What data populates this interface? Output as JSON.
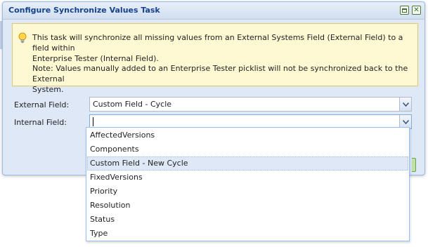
{
  "dialog": {
    "title": "Configure Synchronize Values Task",
    "tools": {
      "maximize_icon": "maximize-icon",
      "close_icon": "close-icon"
    },
    "info": {
      "icon": "lightbulb-icon",
      "line1": "This task will synchronize all missing values from an External Systems Field (External Field) to a field within",
      "line2": "Enterprise Tester (Internal Field).",
      "note1": "Note: Values manually added to an Enterprise Tester picklist will not be synchronized back to the External",
      "note2": "System."
    },
    "external_field": {
      "label": "External Field:",
      "value": "Custom Field - Cycle"
    },
    "internal_field": {
      "label": "Internal Field:",
      "value": ""
    }
  },
  "dropdown": {
    "options": [
      "AffectedVersions",
      "Components",
      "Custom Field - New Cycle",
      "FixedVersions",
      "Priority",
      "Resolution",
      "Status",
      "Type"
    ],
    "highlighted": "Custom Field - New Cycle"
  },
  "colors": {
    "title_text": "#15428b",
    "dialog_bg": "#dfe8f6",
    "info_bg": "#fff9d3",
    "highlight_bg": "#dfe8f6"
  }
}
